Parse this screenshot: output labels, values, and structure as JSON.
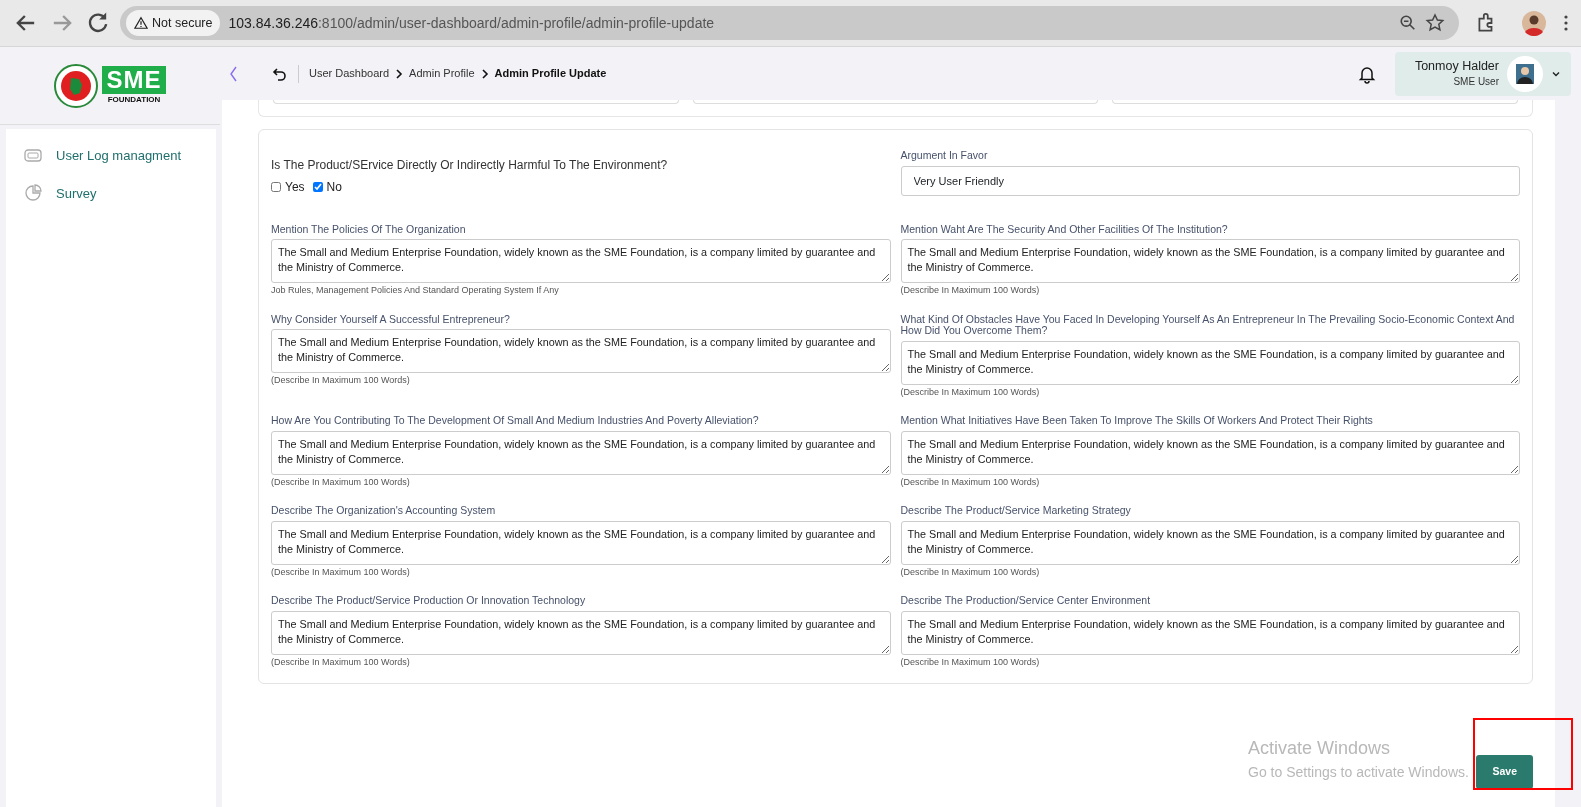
{
  "browser": {
    "security": "Not secure",
    "url_host": "103.84.36.246",
    "url_path": ":8100/admin/user-dashboard/admin-profile/admin-profile-update"
  },
  "logo": {
    "brand": "SME",
    "tagline": "FOUNDATION"
  },
  "sidebar": {
    "items": [
      {
        "label": "User Log managment",
        "kind": "log"
      },
      {
        "label": "Survey",
        "kind": "chart"
      }
    ]
  },
  "breadcrumb": [
    {
      "label": "User Dashboard",
      "current": false
    },
    {
      "label": "Admin Profile",
      "current": false
    },
    {
      "label": "Admin Profile Update",
      "current": true
    }
  ],
  "user": {
    "name": "Tonmoy Halder",
    "role": "SME User"
  },
  "question": {
    "text": "Is The Product/SErvice Directly Or Indirectly Harmful To The Environment?",
    "options": [
      {
        "label": "Yes",
        "checked": false
      },
      {
        "label": "No",
        "checked": true
      }
    ]
  },
  "argument": {
    "label": "Argument In Favor",
    "value": "Very User Friendly"
  },
  "fields": [
    {
      "label": "Mention The Policies Of The Organization",
      "value": "The Small and Medium Enterprise Foundation, widely known as the SME Foundation, is a company limited by guarantee and the Ministry of Commerce.",
      "hint": "Job Rules, Management Policies And Standard Operating System If Any"
    },
    {
      "label": "Mention Waht Are The Security And Other Facilities Of The Institution?",
      "value": "The Small and Medium Enterprise Foundation, widely known as the SME Foundation, is a company limited by guarantee and the Ministry of Commerce.",
      "hint": "(Describe In Maximum 100 Words)"
    },
    {
      "label": "Why Consider Yourself A Successful Entrepreneur?",
      "value": "The Small and Medium Enterprise Foundation, widely known as the SME Foundation, is a company limited by guarantee and the Ministry of Commerce.",
      "hint": "(Describe In Maximum 100 Words)"
    },
    {
      "label": "What Kind Of Obstacles Have You Faced In Developing Yourself As An Entrepreneur In The Prevailing Socio-Economic Context And How Did You Overcome Them?",
      "value": "The Small and Medium Enterprise Foundation, widely known as the SME Foundation, is a company limited by guarantee and the Ministry of Commerce.",
      "hint": "(Describe In Maximum 100 Words)"
    },
    {
      "label": "How Are You Contributing To The Development Of Small And Medium Industries And Poverty Alleviation?",
      "value": "The Small and Medium Enterprise Foundation, widely known as the SME Foundation, is a company limited by guarantee and the Ministry of Commerce.",
      "hint": "(Describe In Maximum 100 Words)"
    },
    {
      "label": "Mention What Initiatives Have Been Taken To Improve The Skills Of Workers And Protect Their Rights",
      "value": "The Small and Medium Enterprise Foundation, widely known as the SME Foundation, is a company limited by guarantee and the Ministry of Commerce.",
      "hint": "(Describe In Maximum 100 Words)"
    },
    {
      "label": "Describe The Organization's Accounting System",
      "value": "The Small and Medium Enterprise Foundation, widely known as the SME Foundation, is a company limited by guarantee and the Ministry of Commerce.",
      "hint": "(Describe In Maximum 100 Words)"
    },
    {
      "label": "Describe The Product/Service Marketing Strategy",
      "value": "The Small and Medium Enterprise Foundation, widely known as the SME Foundation, is a company limited by guarantee and the Ministry of Commerce.",
      "hint": "(Describe In Maximum 100 Words)"
    },
    {
      "label": "Describe The Product/Service Production Or Innovation Technology",
      "value": "The Small and Medium Enterprise Foundation, widely known as the SME Foundation, is a company limited by guarantee and the Ministry of Commerce.",
      "hint": "(Describe In Maximum 100 Words)"
    },
    {
      "label": "Describe The Production/Service Center Environment",
      "value": "The Small and Medium Enterprise Foundation, widely known as the SME Foundation, is a company limited by guarantee and the Ministry of Commerce.",
      "hint": "(Describe In Maximum 100 Words)"
    }
  ],
  "save_button": "Save",
  "os_notice": {
    "title": "Activate Windows",
    "text": "Go to Settings to activate Windows."
  }
}
